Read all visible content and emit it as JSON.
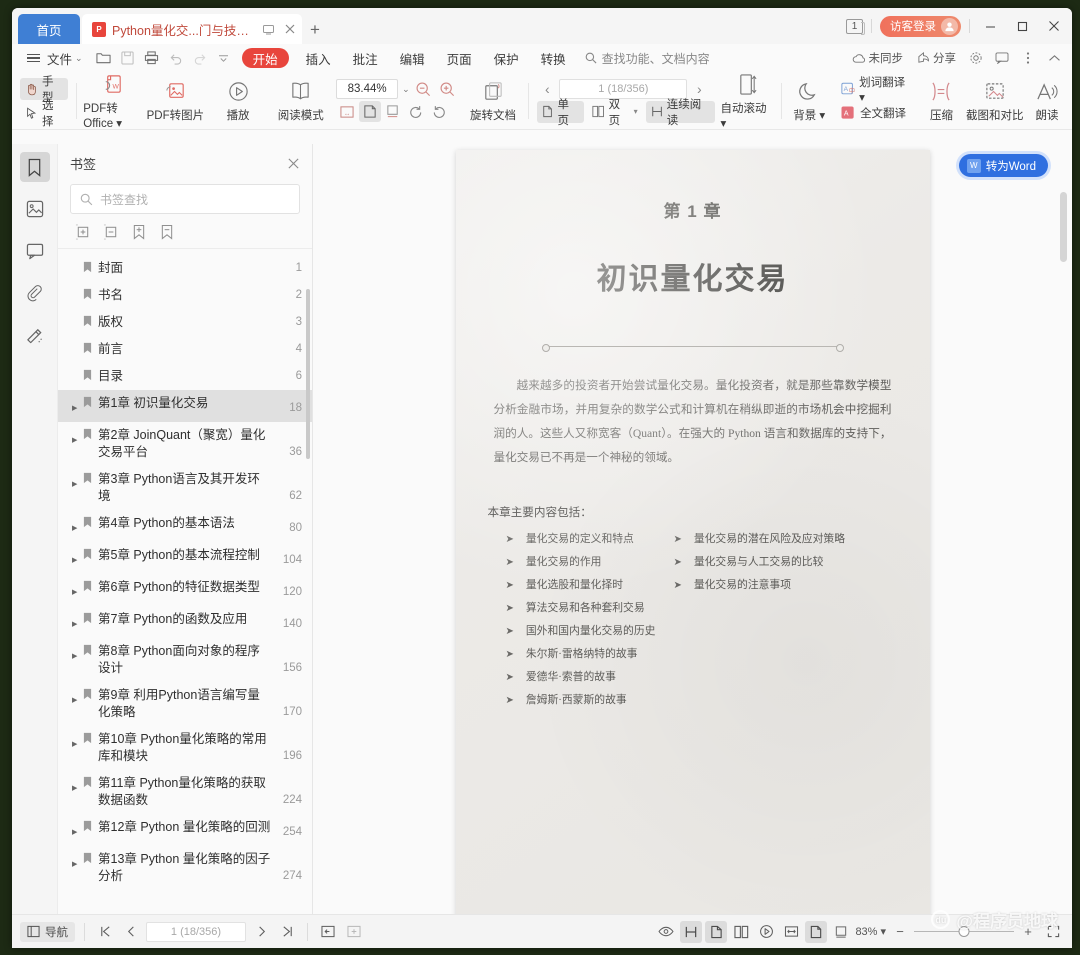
{
  "window": {
    "tabs": [
      {
        "label": "首页",
        "type": "home"
      },
      {
        "label": "Python量化交...门与技巧_.pdf",
        "type": "pdf"
      }
    ],
    "new_tab_label": "+",
    "doc_count": "1",
    "login_label": "访客登录",
    "minimize": "—",
    "maximize": "□",
    "close": "✕"
  },
  "menubar": {
    "file_label": "文件",
    "file_caret": "⌄",
    "quick_icons": [
      "open-folder-icon",
      "save-icon",
      "print-icon",
      "undo-icon",
      "redo-icon",
      "more-caret-icon"
    ],
    "start_label": "开始",
    "tabs": [
      "插入",
      "批注",
      "编辑",
      "页面",
      "保护",
      "转换"
    ],
    "search_placeholder": "查找功能、文档内容",
    "sync_label": "未同步",
    "share_label": "分享",
    "settings_icon": "gear-icon",
    "feedback_icon": "comment-icon",
    "more_icon": "more-vertical-icon",
    "collapse_icon": "chevron-up-icon"
  },
  "ribbon": {
    "hand_label": "手型",
    "select_label": "选择",
    "pdf_to_office": "PDF转Office",
    "pdf_to_image": "PDF转图片",
    "play": "播放",
    "read_mode": "阅读模式",
    "zoom_value": "83.44%",
    "zoom_out_icon": "zoom-out-icon",
    "zoom_in_icon": "zoom-in-icon",
    "fit_width_icon": "fit-width-icon",
    "fit_page_icon": "fit-page-icon",
    "actual_size_icon": "actual-size-icon",
    "rotate_ccw_icon": "rotate-ccw-icon",
    "rotate_cw_icon": "rotate-cw-icon",
    "rotate_doc": "旋转文档",
    "page_field": "1 (18/356)",
    "prev_page_icon": "chevron-left-icon",
    "next_page_icon": "chevron-right-icon",
    "single_page": "单页",
    "dual_page": "双页",
    "continuous_read": "连续阅读",
    "auto_scroll": "自动滚动",
    "background": "背景",
    "word_translate": "划词翻译",
    "full_translate": "全文翻译",
    "compress": "压缩",
    "screenshot_compare": "截图和对比",
    "read_aloud": "朗读"
  },
  "sidebar": {
    "rail": [
      {
        "name": "bookmark-icon",
        "active": true
      },
      {
        "name": "thumbnail-icon",
        "active": false
      },
      {
        "name": "comment-icon",
        "active": false
      },
      {
        "name": "attachment-icon",
        "active": false
      },
      {
        "name": "signature-icon",
        "active": false
      }
    ],
    "panel_title": "书签",
    "close_icon": "close-icon",
    "search_placeholder": "书签查找",
    "tools": [
      "expand-all-icon",
      "collapse-all-icon",
      "add-bookmark-icon",
      "bookmark-options-icon"
    ],
    "bookmarks": [
      {
        "label": "封面",
        "page": "1",
        "expandable": false,
        "selected": false
      },
      {
        "label": "书名",
        "page": "2",
        "expandable": false,
        "selected": false
      },
      {
        "label": "版权",
        "page": "3",
        "expandable": false,
        "selected": false
      },
      {
        "label": "前言",
        "page": "4",
        "expandable": false,
        "selected": false
      },
      {
        "label": "目录",
        "page": "6",
        "expandable": false,
        "selected": false
      },
      {
        "label": "第1章 初识量化交易",
        "page": "18",
        "expandable": true,
        "selected": true
      },
      {
        "label": "第2章 JoinQuant（聚宽）量化交易平台",
        "page": "36",
        "expandable": true,
        "selected": false
      },
      {
        "label": "第3章 Python语言及其开发环境",
        "page": "62",
        "expandable": true,
        "selected": false
      },
      {
        "label": "第4章 Python的基本语法",
        "page": "80",
        "expandable": true,
        "selected": false
      },
      {
        "label": "第5章 Python的基本流程控制",
        "page": "104",
        "expandable": true,
        "selected": false
      },
      {
        "label": "第6章 Python的特征数据类型",
        "page": "120",
        "expandable": true,
        "selected": false
      },
      {
        "label": "第7章 Python的函数及应用",
        "page": "140",
        "expandable": true,
        "selected": false
      },
      {
        "label": "第8章 Python面向对象的程序设计",
        "page": "156",
        "expandable": true,
        "selected": false
      },
      {
        "label": "第9章 利用Python语言编写量化策略",
        "page": "170",
        "expandable": true,
        "selected": false
      },
      {
        "label": "第10章 Python量化策略的常用库和模块",
        "page": "196",
        "expandable": true,
        "selected": false
      },
      {
        "label": "第11章 Python量化策略的获取数据函数",
        "page": "224",
        "expandable": true,
        "selected": false
      },
      {
        "label": "第12章 Python 量化策略的回测",
        "page": "254",
        "expandable": true,
        "selected": false
      },
      {
        "label": "第13章 Python 量化策略的因子分析",
        "page": "274",
        "expandable": true,
        "selected": false
      }
    ]
  },
  "document": {
    "convert_word_label": "转为Word",
    "chapter_number": "第 1 章",
    "chapter_title": "初识量化交易",
    "paragraph": "越来越多的投资者开始尝试量化交易。量化投资者，就是那些靠数学模型分析金融市场，并用复杂的数学公式和计算机在稍纵即逝的市场机会中挖掘利润的人。这些人又称宽客（Quant）。在强大的 Python 语言和数据库的支持下，量化交易已不再是一个神秘的领域。",
    "subheading": "本章主要内容包括：",
    "bullets_left": [
      "量化交易的定义和特点",
      "量化交易的作用",
      "量化选股和量化择时",
      "算法交易和各种套利交易",
      "国外和国内量化交易的历史",
      "朱尔斯·雷格纳特的故事",
      "爱德华·索普的故事",
      "詹姆斯·西蒙斯的故事"
    ],
    "bullets_right": [
      "量化交易的潜在风险及应对策略",
      "量化交易与人工交易的比较",
      "量化交易的注意事项"
    ],
    "bullet_glyph": "➤"
  },
  "statusbar": {
    "nav_label": "导航",
    "first_page_icon": "first-page-icon",
    "prev_page_icon": "prev-page-icon",
    "page_field": "1 (18/356)",
    "next_page_icon": "next-page-icon",
    "last_page_icon": "last-page-icon",
    "pane_left_icon": "pane-left-icon",
    "pane_right_icon": "pane-right-icon",
    "eye_icon": "eye-icon",
    "continuous_icon": "continuous-scroll-icon",
    "single_icon": "single-page-icon",
    "dual_icon": "dual-page-icon",
    "play_icon": "play-icon",
    "fit_width_icon": "fit-width-icon",
    "fit_page_icon": "fit-page-icon",
    "actual_icon": "actual-size-icon",
    "zoom_label": "83%",
    "zoom_caret": "▾",
    "zoom_minus": "−",
    "zoom_plus": "+",
    "fullscreen_icon": "fullscreen-icon"
  },
  "watermark": {
    "text": "@程序员地球",
    "badge": "du"
  },
  "colors": {
    "accent_red": "#e8453c",
    "accent_blue": "#3f7fd4",
    "word_blue": "#2f6fe0",
    "login_orange": "#f0715c"
  }
}
